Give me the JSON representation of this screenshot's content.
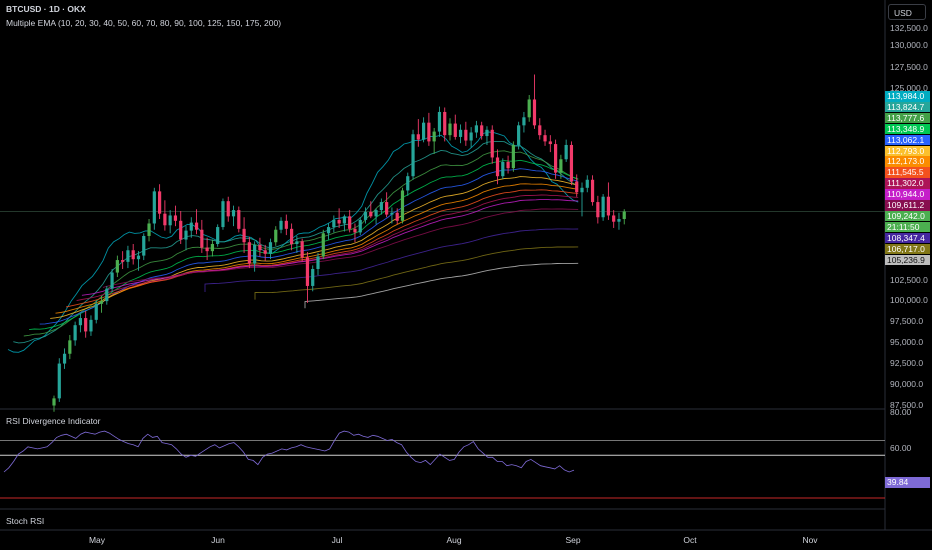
{
  "header": {
    "symbol": "BTCUSD · 1D · OKX",
    "indicator": "Multiple EMA (10, 20, 30, 40, 50, 60, 70, 80, 90, 100, 125, 150, 175, 200)"
  },
  "currency_button": "USD",
  "panels": {
    "rsi_title": "RSI Divergence Indicator",
    "stoch_title": "Stoch RSI"
  },
  "colors": {
    "background": "#000000",
    "candle_up": "#26a69a",
    "candle_up_bright": "#4caf50",
    "candle_down": "#f23a6a",
    "rsi_line": "#7e6ad6",
    "rsi_band": "#9e9e9e",
    "rsi_low_band": "#c62828"
  },
  "chart_data": {
    "type": "candlestick",
    "x_axis": [
      "May",
      "Jun",
      "Jul",
      "Aug",
      "Sep",
      "Oct",
      "Nov"
    ],
    "y_axis": [
      "132,500.0",
      "130,000.0",
      "127,500.0",
      "125,000.0",
      "102,500.0",
      "100,000.0",
      "97,500.0",
      "95,000.0",
      "92,500.0",
      "90,000.0",
      "87,500.0"
    ],
    "ylim": [
      87500,
      132500
    ],
    "price_tags": [
      {
        "text": "113,984.0",
        "color": "#00acc1"
      },
      {
        "text": "113,824.7",
        "color": "#26a69a"
      },
      {
        "text": "113,777.6",
        "color": "#43a047"
      },
      {
        "text": "113,348.9",
        "color": "#00c853"
      },
      {
        "text": "113,062.1",
        "color": "#2962ff"
      },
      {
        "text": "112,793.0",
        "color": "#fbc02d"
      },
      {
        "text": "112,173.0",
        "color": "#fb8c00"
      },
      {
        "text": "111,545.5",
        "color": "#f4511e"
      },
      {
        "text": "111,302.0",
        "color": "#ad1457"
      },
      {
        "text": "110,944.0",
        "color": "#c51ec9"
      },
      {
        "text": "109,611.2",
        "color": "#880e4f"
      },
      {
        "text": "109,242.0",
        "color": "#4caf50"
      },
      {
        "text": "21:11:50",
        "color": "#4caf50"
      },
      {
        "text": "108,347.4",
        "color": "#4527a0"
      },
      {
        "text": "106,717.0",
        "color": "#827717"
      },
      {
        "text": "105,236.9",
        "color": "#bdbdbd"
      }
    ],
    "ema_periods": [
      10,
      20,
      30,
      40,
      50,
      60,
      70,
      80,
      90,
      100,
      125,
      150,
      175,
      200
    ],
    "ema_latest": [
      113984.0,
      113824.7,
      113777.6,
      113348.9,
      113062.1,
      112793.0,
      112173.0,
      111545.5,
      111302.0,
      110944.0,
      109611.2,
      108347.4,
      106717.0,
      105236.9
    ],
    "last_price": 109242.0,
    "candles": [
      [
        87500,
        88600,
        86800,
        88300
      ],
      [
        88300,
        92800,
        87900,
        92200
      ],
      [
        92200,
        93900,
        91600,
        93300
      ],
      [
        93300,
        95400,
        92700,
        94800
      ],
      [
        94800,
        96900,
        94200,
        96500
      ],
      [
        96500,
        97800,
        95700,
        97300
      ],
      [
        97300,
        98100,
        95100,
        95800
      ],
      [
        95800,
        97600,
        95300,
        97100
      ],
      [
        97100,
        99300,
        96700,
        98900
      ],
      [
        98900,
        99800,
        97900,
        99200
      ],
      [
        99200,
        100900,
        98800,
        100600
      ],
      [
        100600,
        102800,
        100200,
        102400
      ],
      [
        102400,
        104300,
        101900,
        103800
      ],
      [
        103800,
        104800,
        102800,
        103600
      ],
      [
        103600,
        105400,
        102900,
        104900
      ],
      [
        104900,
        105600,
        103300,
        103900
      ],
      [
        103900,
        104800,
        102600,
        104300
      ],
      [
        104300,
        106800,
        103800,
        106500
      ],
      [
        106500,
        108400,
        105900,
        107900
      ],
      [
        107900,
        111900,
        107200,
        111500
      ],
      [
        111500,
        112300,
        108400,
        109000
      ],
      [
        109000,
        110500,
        107100,
        107700
      ],
      [
        107700,
        109400,
        106800,
        108800
      ],
      [
        108800,
        109900,
        107600,
        108200
      ],
      [
        108200,
        109300,
        105600,
        106100
      ],
      [
        106100,
        107600,
        104900,
        107100
      ],
      [
        107100,
        108600,
        106300,
        108000
      ],
      [
        108000,
        109500,
        106700,
        107200
      ],
      [
        107200,
        108300,
        104600,
        105200
      ],
      [
        105200,
        106300,
        103800,
        104800
      ],
      [
        104800,
        106100,
        104200,
        105600
      ],
      [
        105600,
        107800,
        105300,
        107500
      ],
      [
        107500,
        110700,
        107200,
        110400
      ],
      [
        110400,
        110900,
        108100,
        108700
      ],
      [
        108700,
        109900,
        107600,
        109400
      ],
      [
        109400,
        109800,
        106900,
        107300
      ],
      [
        107300,
        108600,
        104600,
        105800
      ],
      [
        105800,
        106400,
        102900,
        103400
      ],
      [
        103400,
        105900,
        102500,
        105500
      ],
      [
        105500,
        106300,
        104200,
        104900
      ],
      [
        104900,
        105500,
        103700,
        104500
      ],
      [
        104500,
        106200,
        103900,
        105800
      ],
      [
        105800,
        107600,
        105400,
        107200
      ],
      [
        107200,
        108600,
        106800,
        108200
      ],
      [
        108200,
        108900,
        106600,
        107300
      ],
      [
        107300,
        107900,
        104900,
        105600
      ],
      [
        105600,
        106500,
        104600,
        105900
      ],
      [
        105900,
        106200,
        103600,
        104100
      ],
      [
        104100,
        104700,
        99000,
        100900
      ],
      [
        100900,
        103200,
        100300,
        102800
      ],
      [
        102800,
        104600,
        102100,
        104200
      ],
      [
        104200,
        107200,
        103900,
        106800
      ],
      [
        106800,
        107900,
        106100,
        107500
      ],
      [
        107500,
        108800,
        106900,
        108300
      ],
      [
        108300,
        109600,
        107400,
        107900
      ],
      [
        107900,
        108900,
        107000,
        108700
      ],
      [
        108700,
        109400,
        106900,
        107300
      ],
      [
        107300,
        107900,
        105800,
        106900
      ],
      [
        106900,
        108600,
        106600,
        108300
      ],
      [
        108300,
        109700,
        107900,
        109200
      ],
      [
        109200,
        110400,
        108500,
        108700
      ],
      [
        108700,
        109600,
        107800,
        109400
      ],
      [
        109400,
        110700,
        108900,
        110300
      ],
      [
        110300,
        111400,
        108600,
        108900
      ],
      [
        108900,
        109700,
        107900,
        109100
      ],
      [
        109100,
        109600,
        107800,
        108200
      ],
      [
        108200,
        111900,
        107900,
        111600
      ],
      [
        111600,
        113600,
        111000,
        113200
      ],
      [
        113200,
        118400,
        112800,
        117900
      ],
      [
        117900,
        119600,
        116500,
        117300
      ],
      [
        117300,
        119800,
        117000,
        119200
      ],
      [
        119200,
        120300,
        116600,
        117100
      ],
      [
        117100,
        118600,
        115700,
        118200
      ],
      [
        118200,
        121000,
        117600,
        120400
      ],
      [
        120400,
        120900,
        117100,
        117800
      ],
      [
        117800,
        119700,
        117200,
        119100
      ],
      [
        119100,
        120100,
        117300,
        117600
      ],
      [
        117600,
        119000,
        116900,
        118400
      ],
      [
        118400,
        119300,
        116600,
        117200
      ],
      [
        117200,
        118700,
        116400,
        118100
      ],
      [
        118100,
        119400,
        117500,
        118900
      ],
      [
        118900,
        119300,
        117300,
        117700
      ],
      [
        117700,
        118800,
        116700,
        118400
      ],
      [
        118400,
        118900,
        114600,
        115300
      ],
      [
        115300,
        116200,
        112300,
        113200
      ],
      [
        113200,
        115200,
        112900,
        114800
      ],
      [
        114800,
        115500,
        113500,
        114100
      ],
      [
        114100,
        117100,
        113700,
        116700
      ],
      [
        116700,
        119300,
        116200,
        118900
      ],
      [
        118900,
        120400,
        118100,
        119800
      ],
      [
        119800,
        122300,
        119300,
        121800
      ],
      [
        121800,
        124600,
        118500,
        118900
      ],
      [
        118900,
        119700,
        117300,
        117800
      ],
      [
        117800,
        118400,
        116600,
        117100
      ],
      [
        117100,
        117800,
        115900,
        116800
      ],
      [
        116800,
        117300,
        112900,
        113600
      ],
      [
        113600,
        115600,
        112900,
        115100
      ],
      [
        115100,
        117300,
        114800,
        116700
      ],
      [
        116700,
        117100,
        112200,
        112600
      ],
      [
        112600,
        113400,
        110900,
        111400
      ],
      [
        111400,
        112500,
        108700,
        111900
      ],
      [
        111900,
        113300,
        111400,
        112800
      ],
      [
        112800,
        113300,
        109900,
        110300
      ],
      [
        110300,
        111000,
        107900,
        108600
      ],
      [
        108600,
        111200,
        108200,
        110900
      ],
      [
        110900,
        112500,
        108300,
        108800
      ],
      [
        108800,
        109400,
        107400,
        108100
      ],
      [
        108100,
        109100,
        107200,
        108400
      ],
      [
        108400,
        109500,
        107800,
        109242
      ]
    ],
    "rsi": {
      "title": "RSI Divergence Indicator",
      "y_axis": [
        "80.00",
        "60.00"
      ],
      "bands": [
        80,
        60,
        40,
        30
      ],
      "last_value": "39.84",
      "values": [
        38,
        42,
        48,
        55,
        58,
        62,
        61,
        60,
        61,
        62,
        66,
        71,
        73,
        74,
        72,
        70,
        74,
        76,
        75,
        74,
        76,
        77,
        75,
        72,
        69,
        67,
        65,
        64,
        62,
        70,
        74,
        71,
        72,
        66,
        65,
        64,
        60,
        55,
        52,
        54,
        53,
        56,
        59,
        62,
        64,
        61,
        63,
        65,
        66,
        62,
        57,
        50,
        49,
        45,
        52,
        55,
        56,
        58,
        60,
        59,
        61,
        62,
        64,
        62,
        61,
        60,
        59,
        58,
        60,
        68,
        75,
        77,
        76,
        73,
        74,
        72,
        71,
        73,
        72,
        70,
        68,
        69,
        66,
        64,
        57,
        52,
        48,
        47,
        49,
        45,
        50,
        55,
        52,
        49,
        50,
        57,
        62,
        64,
        67,
        60,
        56,
        52,
        52,
        48,
        48,
        44,
        45,
        44,
        42,
        48,
        50,
        47,
        44,
        43,
        42,
        41,
        44,
        40,
        38,
        39.84
      ]
    }
  }
}
